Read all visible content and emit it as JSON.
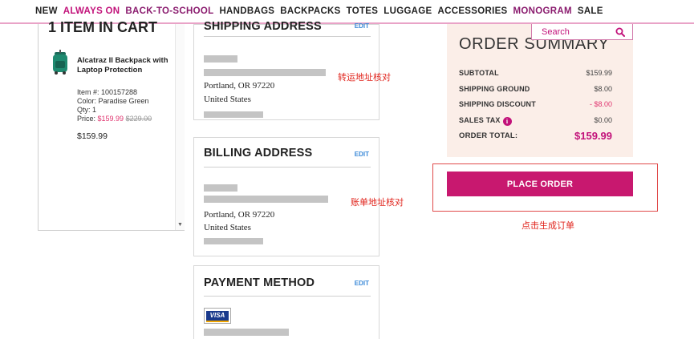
{
  "nav": {
    "items": [
      {
        "label": "NEW",
        "style": "plain"
      },
      {
        "label": "ALWAYS ON",
        "style": "accent"
      },
      {
        "label": "BACK-TO-SCHOOL",
        "style": "accent2"
      },
      {
        "label": "HANDBAGS",
        "style": "plain"
      },
      {
        "label": "BACKPACKS",
        "style": "plain"
      },
      {
        "label": "TOTES",
        "style": "plain"
      },
      {
        "label": "LUGGAGE",
        "style": "plain"
      },
      {
        "label": "ACCESSORIES",
        "style": "plain"
      },
      {
        "label": "MONOGRAM",
        "style": "accent2"
      },
      {
        "label": "SALE",
        "style": "plain"
      }
    ]
  },
  "search": {
    "placeholder": "Search",
    "icon": "search-icon"
  },
  "cart": {
    "title": "1 ITEM IN CART",
    "item": {
      "name": "Alcatraz II Backpack with Laptop Protection",
      "item_number": "Item #: 100157288",
      "color": "Color: Paradise Green",
      "qty": "Qty: 1",
      "price_label": "Price:",
      "price_sale": "$159.99",
      "price_original": "$229.00",
      "line_total": "$159.99"
    }
  },
  "shipping": {
    "title": "SHIPPING ADDRESS",
    "edit_label": "EDIT",
    "city_line": "Portland, OR 97220",
    "country": "United States"
  },
  "billing": {
    "title": "BILLING ADDRESS",
    "edit_label": "EDIT",
    "city_line": "Portland, OR 97220",
    "country": "United States"
  },
  "payment": {
    "title": "PAYMENT METHOD",
    "edit_label": "EDIT",
    "card_brand": "VISA"
  },
  "summary": {
    "title": "ORDER SUMMARY",
    "rows": [
      {
        "label": "SUBTOTAL",
        "value": "$159.99"
      },
      {
        "label": "SHIPPING GROUND",
        "value": "$8.00"
      },
      {
        "label": "SHIPPING DISCOUNT",
        "value": "- $8.00"
      },
      {
        "label": "SALES TAX",
        "value": "$0.00"
      }
    ],
    "total_label": "ORDER TOTAL:",
    "total_value": "$159.99"
  },
  "place_order": {
    "label": "PLACE ORDER"
  },
  "annotations": {
    "shipping_check": "转运地址核对",
    "billing_check": "账单地址核对",
    "place_order_note": "点击生成订单"
  },
  "colors": {
    "accent": "#c8186f",
    "summary_bg": "#fbeee8",
    "annotation": "#e0231b",
    "link": "#3b8ad8"
  }
}
